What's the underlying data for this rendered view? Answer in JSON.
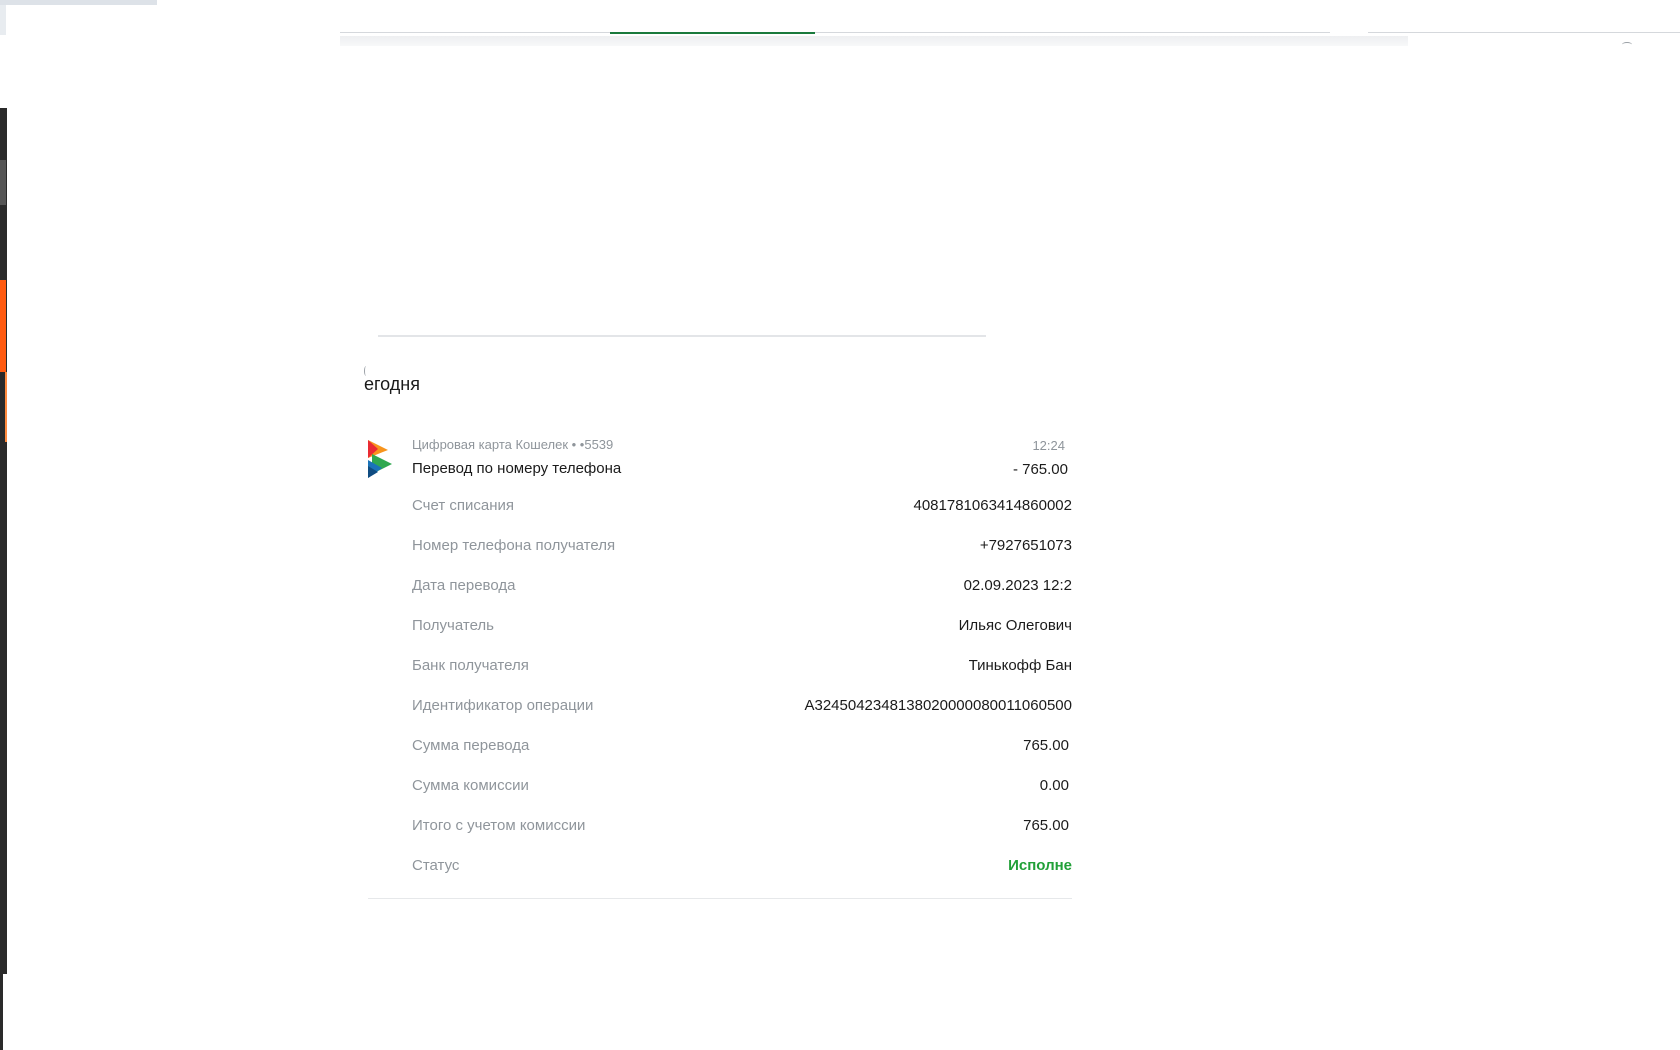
{
  "date_group": {
    "label": "егодня"
  },
  "transaction": {
    "account": "Цифровая карта Кошелек • •5539",
    "title": "Перевод по номеру телефона",
    "time": "12:24",
    "amount": "- 765.00",
    "icon": "provider-logo-icon"
  },
  "details": [
    {
      "label": "Счет списания",
      "value": "4081781063414860002"
    },
    {
      "label": "Номер телефона получателя",
      "value": "+7927651073"
    },
    {
      "label": "Дата перевода",
      "value": "02.09.2023 12:2"
    },
    {
      "label": "Получатель",
      "value": "Ильяс Олегович"
    },
    {
      "label": "Банк получателя",
      "value": "Тинькофф Бан"
    },
    {
      "label": "Идентификатор операции",
      "value": "A3245042348138020000080011060500"
    },
    {
      "label": "Сумма перевода",
      "value": "765.00"
    },
    {
      "label": "Сумма комиссии",
      "value": "0.00"
    },
    {
      "label": "Итого с учетом комиссии",
      "value": "765.00"
    },
    {
      "label": "Статус",
      "value": "Исполне"
    }
  ],
  "colors": {
    "accent_green": "#1a7a3c",
    "status_green": "#21a038",
    "sidebar_orange": "#ff5a0f",
    "sidebar_dark": "#2a2a2a"
  }
}
